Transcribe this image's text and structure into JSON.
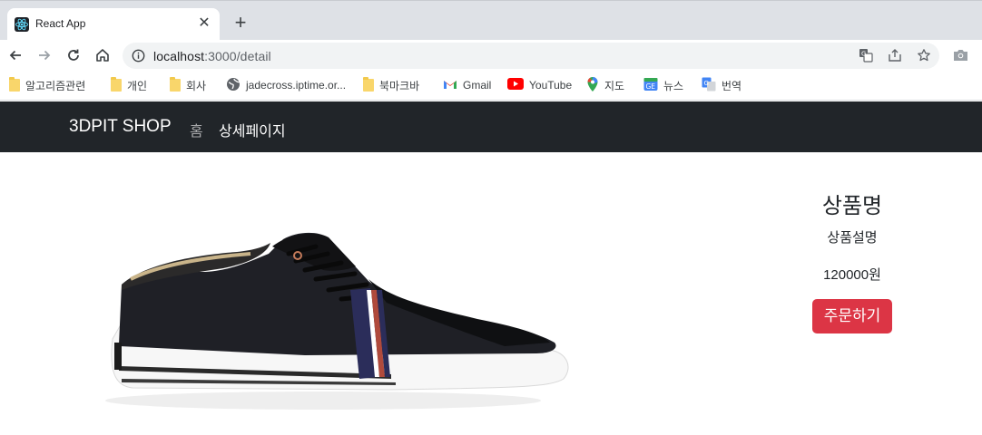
{
  "browser": {
    "tab": {
      "title": "React App"
    },
    "address": {
      "host": "localhost",
      "path": ":3000/detail"
    },
    "bookmarks": [
      {
        "label": "알고리즘관련",
        "icon": "folder-icon"
      },
      {
        "label": "개인",
        "icon": "folder-icon"
      },
      {
        "label": "회사",
        "icon": "folder-icon"
      },
      {
        "label": "jadecross.iptime.or...",
        "icon": "globe-icon"
      },
      {
        "label": "북마크바",
        "icon": "folder-icon"
      },
      {
        "label": "Gmail",
        "icon": "gmail-icon"
      },
      {
        "label": "YouTube",
        "icon": "youtube-icon"
      },
      {
        "label": "지도",
        "icon": "maps-icon"
      },
      {
        "label": "뉴스",
        "icon": "news-icon"
      },
      {
        "label": "번역",
        "icon": "translate-icon"
      }
    ]
  },
  "navbar": {
    "brand": "3DPIT SHOP",
    "links": [
      "홈",
      "상세페이지"
    ]
  },
  "product": {
    "name": "상품명",
    "description": "상품설명",
    "price": "120000원",
    "order_label": "주문하기",
    "image_icon": "sneaker-image"
  },
  "colors": {
    "navbar_bg": "#212529",
    "order_button": "#dc3545",
    "tab_strip": "#dee1e6"
  }
}
